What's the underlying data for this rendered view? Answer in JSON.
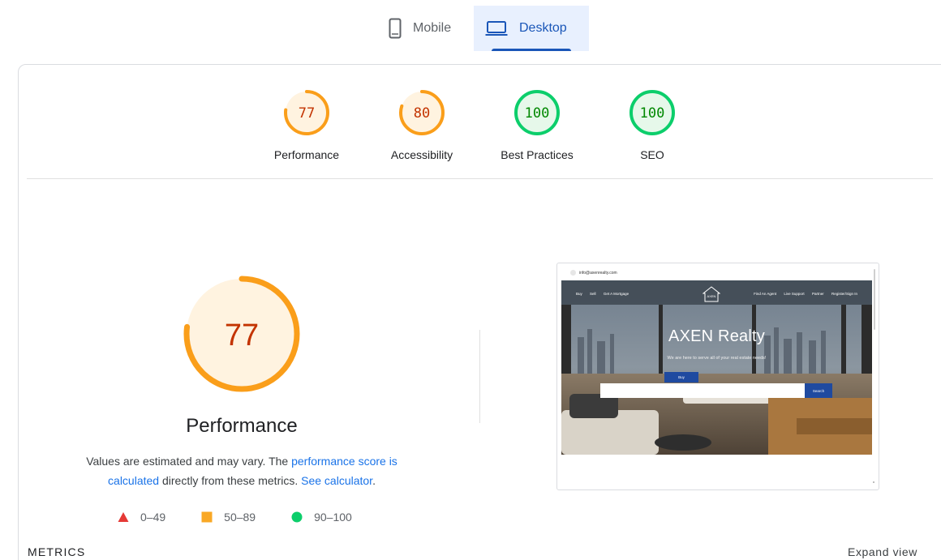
{
  "device_tabs": [
    {
      "label": "Mobile",
      "icon": "phone-icon",
      "selected": false
    },
    {
      "label": "Desktop",
      "icon": "laptop-icon",
      "selected": true
    }
  ],
  "categories": [
    {
      "label": "Performance",
      "score": "77",
      "value": 0.77,
      "status": "average"
    },
    {
      "label": "Accessibility",
      "score": "80",
      "value": 0.8,
      "status": "average"
    },
    {
      "label": "Best Practices",
      "score": "100",
      "value": 1.0,
      "status": "pass"
    },
    {
      "label": "SEO",
      "score": "100",
      "value": 1.0,
      "status": "pass"
    }
  ],
  "performance": {
    "score": "77",
    "value": 0.77,
    "title": "Performance",
    "desc_prefix": "Values are estimated and may vary. The ",
    "desc_link1": "performance score is calculated",
    "desc_middle": " directly from these metrics. ",
    "desc_link2": "See calculator",
    "desc_suffix": "."
  },
  "legend": [
    {
      "range": "0–49",
      "shape": "triangle-icon",
      "color": "#e53935"
    },
    {
      "range": "50–89",
      "shape": "square-icon",
      "color": "#f9a825"
    },
    {
      "range": "90–100",
      "shape": "circle-icon",
      "color": "#0cce6b"
    }
  ],
  "thumbnail": {
    "email": "info@axenrealty.com",
    "nav_left": [
      "Buy",
      "Sell",
      "Get A Mortgage"
    ],
    "nav_right": [
      "Find An Agent",
      "Live Support",
      "Partner",
      "Register/Sign In"
    ],
    "logo": "AXEN",
    "brand": "AXEN Realty",
    "tagline": "We are here to serve all of your real estate needs!",
    "buy_tab": "Buy",
    "search_button": "Search"
  },
  "metrics_heading": "METRICS",
  "expand_label": "Expand view",
  "colors": {
    "average": "#fa9e1a",
    "average_text": "#c33300",
    "average_bg": "#fff3e0",
    "pass": "#0cce6b",
    "pass_text": "#008800",
    "pass_bg": "#e6f8ea",
    "accent": "#1a56b8"
  }
}
